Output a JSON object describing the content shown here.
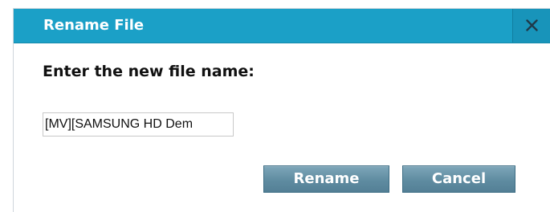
{
  "dialog": {
    "title": "Rename File",
    "close_icon": "close-icon",
    "prompt": "Enter the new file name:",
    "filename_value": "[MV][SAMSUNG HD Dem",
    "rename_label": "Rename",
    "cancel_label": "Cancel"
  },
  "colors": {
    "titlebar": "#1ba0c7",
    "button": "#5f8ca1"
  }
}
